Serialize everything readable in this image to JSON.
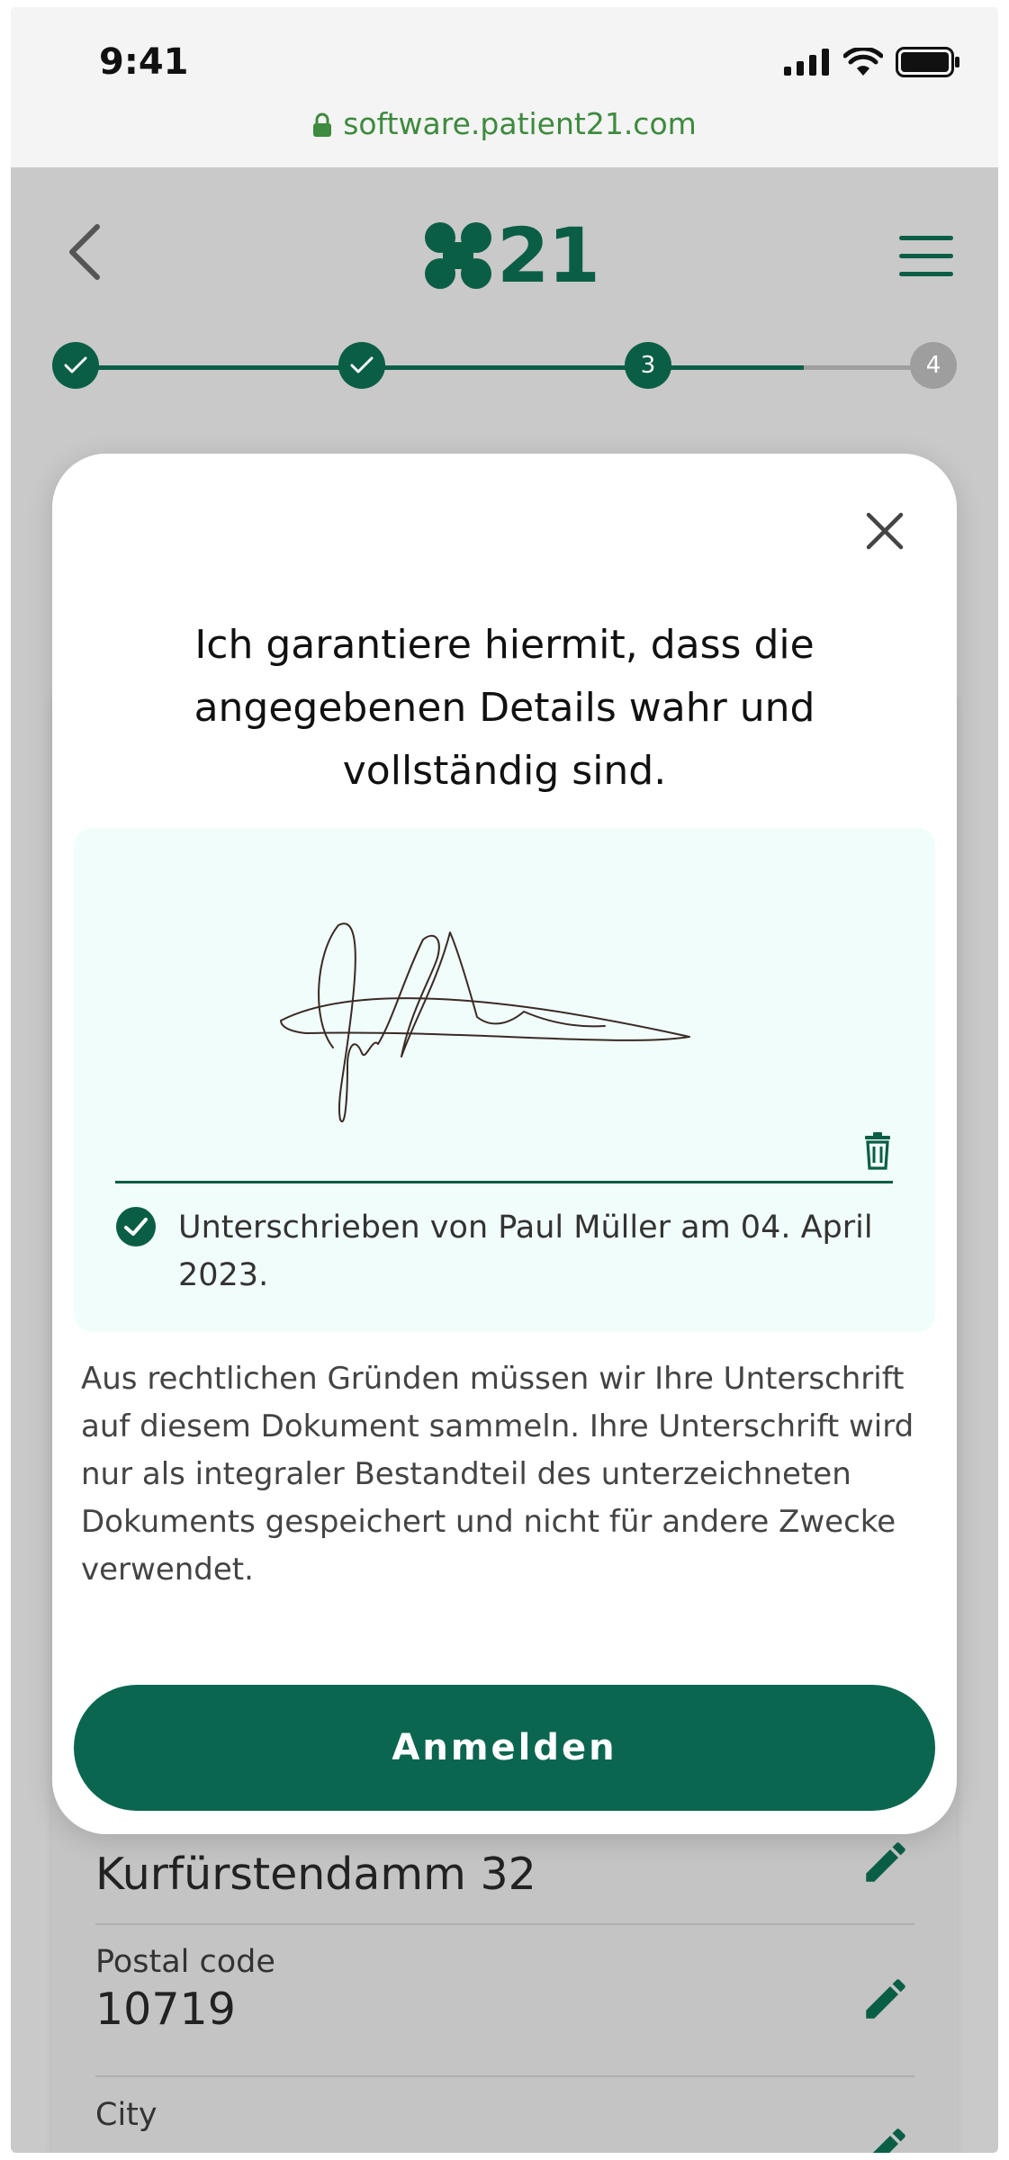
{
  "status_bar": {
    "time": "9:41"
  },
  "browser": {
    "url": "software.patient21.com"
  },
  "header": {
    "logo_text": "21"
  },
  "stepper": {
    "current_step": 3,
    "steps": [
      {
        "state": "done",
        "label": ""
      },
      {
        "state": "done",
        "label": ""
      },
      {
        "state": "current",
        "label": "3"
      },
      {
        "state": "upcoming",
        "label": "4"
      }
    ],
    "progress": 0.85
  },
  "modal": {
    "title": "Ich garantiere hiermit, dass die angegebenen Details wahr und vollständig sind.",
    "signed_text": "Unterschrieben von Paul Müller am 04. April 2023.",
    "legal_text": "Aus rechtlichen Gründen müssen wir Ihre Unterschrift auf diesem Dokument sammeln. Ihre Unterschrift wird nur als integraler Bestandteil des unterzeichneten Dokuments gespeichert und nicht für andere Zwecke verwendet.",
    "submit_label": "Anmelden"
  },
  "form": {
    "street_value": "Kurfürstendamm 32",
    "postal_code_label": "Postal code",
    "postal_code_value": "10719",
    "city_label": "City"
  },
  "colors": {
    "primary": "#0b5e46",
    "button": "#0b6650",
    "signature_bg": "#f1fdfa",
    "url_green": "#3e8a3e",
    "overlay": "#c9c9c9"
  }
}
